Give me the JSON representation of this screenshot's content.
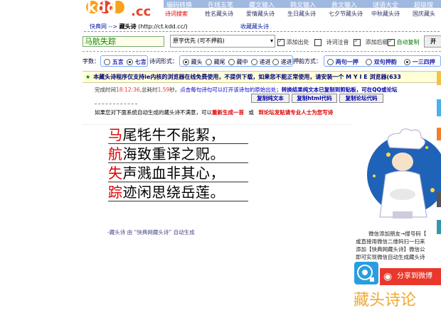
{
  "header": {
    "top_nav": [
      "编码转换",
      "在线五笔",
      "藏文输入",
      "韩文输入",
      "彝文输入",
      "谜语大全",
      "超级搜"
    ],
    "sub_nav": [
      "诗词搜索",
      "姓名藏头诗",
      "爱情藏头诗",
      "生日藏头诗",
      "七夕节藏头诗",
      "中秋藏头诗",
      "国庆藏头"
    ],
    "logo_text": "kdd.cc"
  },
  "breadcrumb": {
    "home": "快典网",
    "arrow": "-->",
    "current": "藏头诗",
    "url": "(http://ct.kdd.cc/)",
    "favorite": "收藏藏头诗"
  },
  "form": {
    "name_value": "马航失踪",
    "mode_value": "原字优先 (可不押韵)",
    "options": [
      {
        "label": "添加出处",
        "checked": true
      },
      {
        "label": "诗词注音",
        "checked": false
      },
      {
        "label": "添加后缀",
        "checked": true
      },
      {
        "label": "自动复制",
        "checked": true
      }
    ],
    "start_label": "开",
    "char_count_label": "字数：",
    "char_counts": [
      {
        "label": "五言",
        "selected": false
      },
      {
        "label": "七言",
        "selected": true
      }
    ],
    "form_label": "诗词形式：",
    "forms": [
      {
        "label": "藏头",
        "selected": true
      },
      {
        "label": "藏尾",
        "selected": false
      },
      {
        "label": "藏中",
        "selected": false
      },
      {
        "label": "递进",
        "selected": false
      },
      {
        "label": "递进",
        "selected": false
      }
    ],
    "rhyme_label": "押韵方式：",
    "rhymes": [
      {
        "label": "两句一押",
        "selected": false
      },
      {
        "label": "双句押韵",
        "selected": false
      },
      {
        "label": "一三四押",
        "selected": true
      }
    ]
  },
  "notice": "本藏头诗程序仅支持ie内核的浏览器在线免费使用，不提供下载，如果您不能正常使用，请安装一个 M Y I E 浏览器(633",
  "status": {
    "prefix": "完成时间",
    "time": "18:12:36",
    "total": ",总耗时",
    "seconds": "1.59",
    "unit": "秒。",
    "tip": "点击每句诗句可以打开该诗句的原始出处；",
    "tip2": "转换结果纯文本已复制到剪贴板，可在QQ或论坛",
    "buttons": [
      "复制纯文本",
      "复制html代码",
      "复制论坛代码"
    ]
  },
  "hint": {
    "text": "如果您对下面系统自动生成的藏头诗不满意，可以",
    "regen": "重新生成一首",
    "or": "或",
    "expert": "到论坛发贴请专业人士为您写诗"
  },
  "poem": {
    "lines": [
      {
        "first": "马",
        "rest": "尾牦牛不能絜，"
      },
      {
        "first": "航",
        "rest": "海致重译之贶。"
      },
      {
        "first": "失",
        "rest": "声溅血非其心，"
      },
      {
        "first": "踪",
        "rest": "迹闲思绕岳莲。"
      }
    ],
    "credit": "-藏头诗 由 “快典网藏头诗” 自动生成"
  },
  "ad": {
    "lines": [
      "微信添加朋友→搜号码【",
      "或直接用微信二维码扫一扫来",
      "添加【快典网藏头诗】微信公",
      "即可实现微信自动生成藏头诗"
    ],
    "share": "分享到微博",
    "big_title": "藏头诗论"
  }
}
